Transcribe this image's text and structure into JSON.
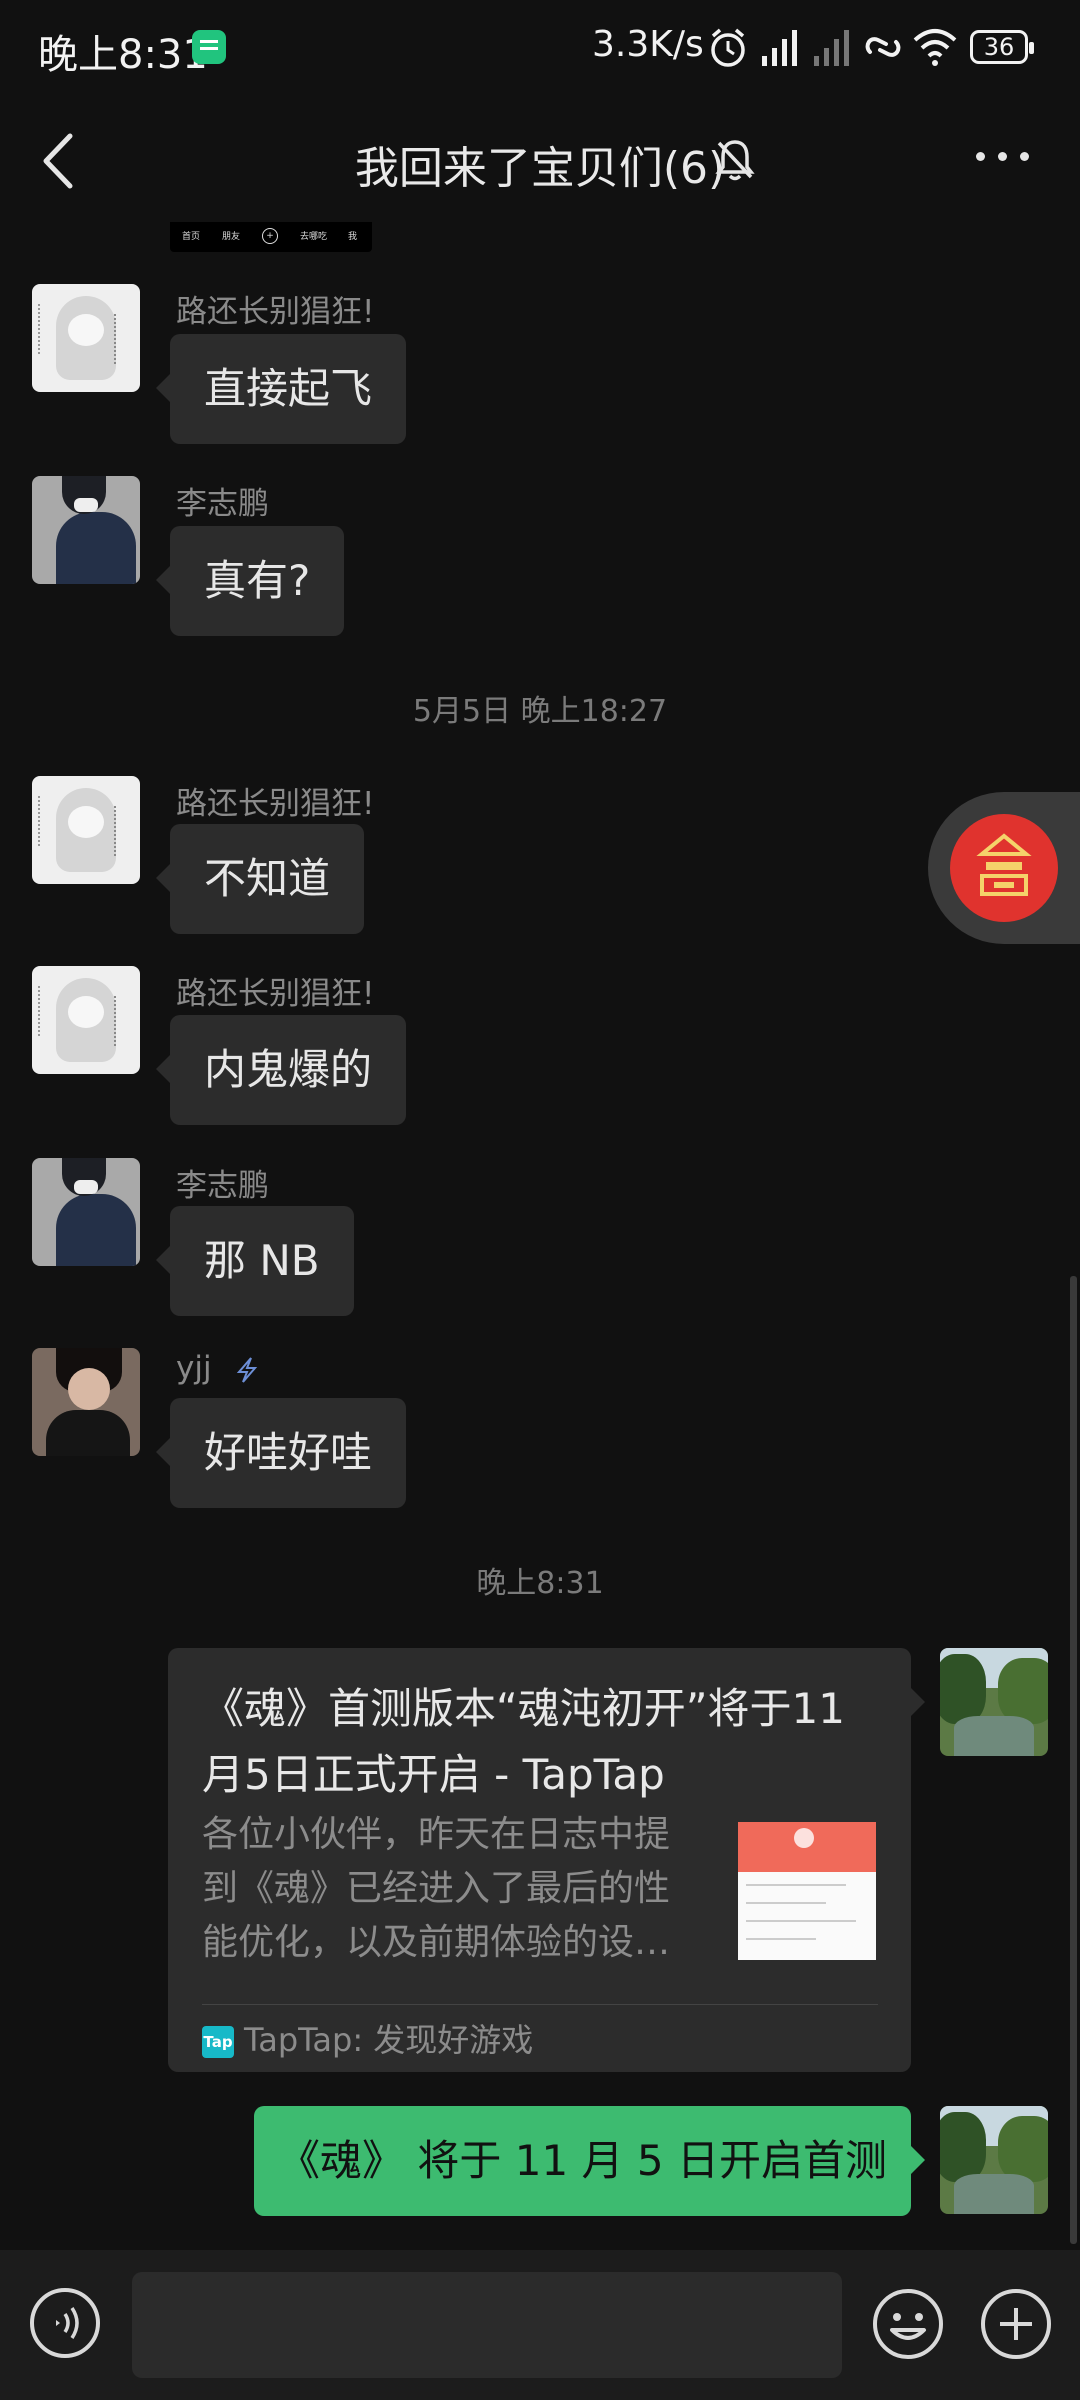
{
  "status_bar": {
    "time": "晚上8:31",
    "net_speed": "3.3K/s",
    "battery": "36"
  },
  "header": {
    "title": "我回来了宝贝们(6)"
  },
  "partial_image": {
    "labels": [
      "首页",
      "朋友",
      "+",
      "去哪吃",
      "我"
    ]
  },
  "messages": [
    {
      "sender": "路还长别猖狂!",
      "text": "直接起飞"
    },
    {
      "sender": "李志鹏",
      "text": "真有?"
    },
    {
      "sender": "路还长别猖狂!",
      "text": "不知道"
    },
    {
      "sender": "路还长别猖狂!",
      "text": "内鬼爆的"
    },
    {
      "sender": "李志鹏",
      "text": "那 NB"
    },
    {
      "sender": "yjj",
      "text": "好哇好哇"
    }
  ],
  "timestamps": [
    "5月5日 晚上18:27",
    "晚上8:31"
  ],
  "link_card": {
    "title": "《魂》首测版本“魂沌初开”将于11月5日正式开启 - TapTap",
    "description": "各位小伙伴，昨天在日志中提到《魂》已经进入了最后的性能优化，以及前期体验的设…",
    "source_icon": "Tap",
    "source": "TapTap: 发现好游戏"
  },
  "outgoing_text": "《魂》 将于 11 月 5 日开启首测",
  "input": {
    "value": ""
  },
  "colors": {
    "background": "#111111",
    "bubble": "#2c2c2c",
    "outgoing_bubble": "#3dbb70",
    "red_packet": "#e0332e"
  }
}
